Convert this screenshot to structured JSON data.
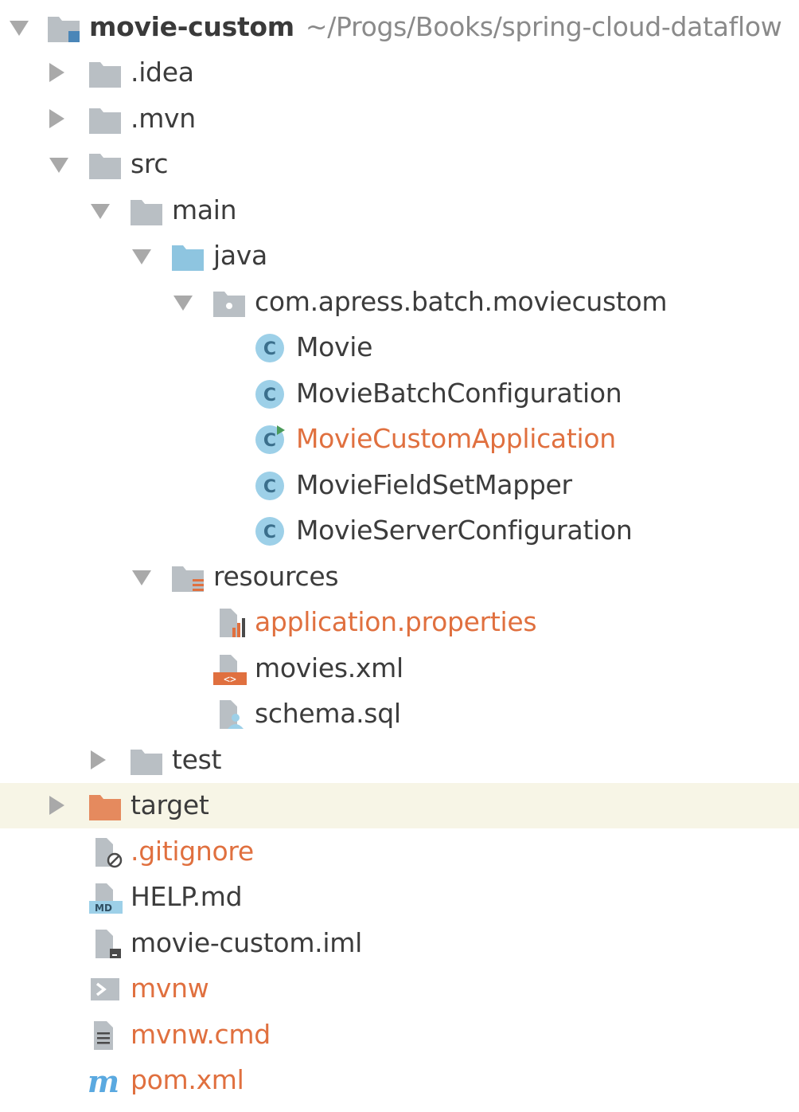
{
  "project": {
    "name": "movie-custom",
    "path": "~/Progs/Books/spring-cloud-dataflow"
  },
  "colors": {
    "folder": "#b9bfc4",
    "source_folder": "#8ec5e0",
    "excluded_folder": "#e58a5e",
    "class_circle": "#9dd0e8",
    "modified_text": "#e0703f",
    "selection": "#f7f5e6"
  },
  "tree": {
    "idea": ".idea",
    "mvn": ".mvn",
    "src": "src",
    "main": "main",
    "java": "java",
    "package": "com.apress.batch.moviecustom",
    "classes": {
      "movie": "Movie",
      "batch_config": "MovieBatchConfiguration",
      "custom_app": "MovieCustomApplication",
      "field_set_mapper": "MovieFieldSetMapper",
      "server_config": "MovieServerConfiguration"
    },
    "resources": "resources",
    "application_properties": "application.properties",
    "movies_xml": "movies.xml",
    "schema_sql": "schema.sql",
    "test": "test",
    "target": "target",
    "gitignore": ".gitignore",
    "help_md": "HELP.md",
    "iml": "movie-custom.iml",
    "mvnw": "mvnw",
    "mvnw_cmd": "mvnw.cmd",
    "pom": "pom.xml"
  },
  "icons": {
    "module": "module-folder-icon",
    "folder": "folder-icon",
    "source_folder": "source-folder-icon",
    "package": "package-icon",
    "class": "java-class-icon",
    "main_class": "java-main-class-icon",
    "resources_folder": "resources-folder-icon",
    "properties": "properties-file-icon",
    "xml": "xml-file-icon",
    "sql": "sql-file-icon",
    "excluded_folder": "excluded-folder-icon",
    "ignore": "ignore-file-icon",
    "markdown": "markdown-file-icon",
    "iml": "iml-file-icon",
    "shell": "shell-script-icon",
    "text": "text-file-icon",
    "maven": "maven-pom-icon"
  }
}
